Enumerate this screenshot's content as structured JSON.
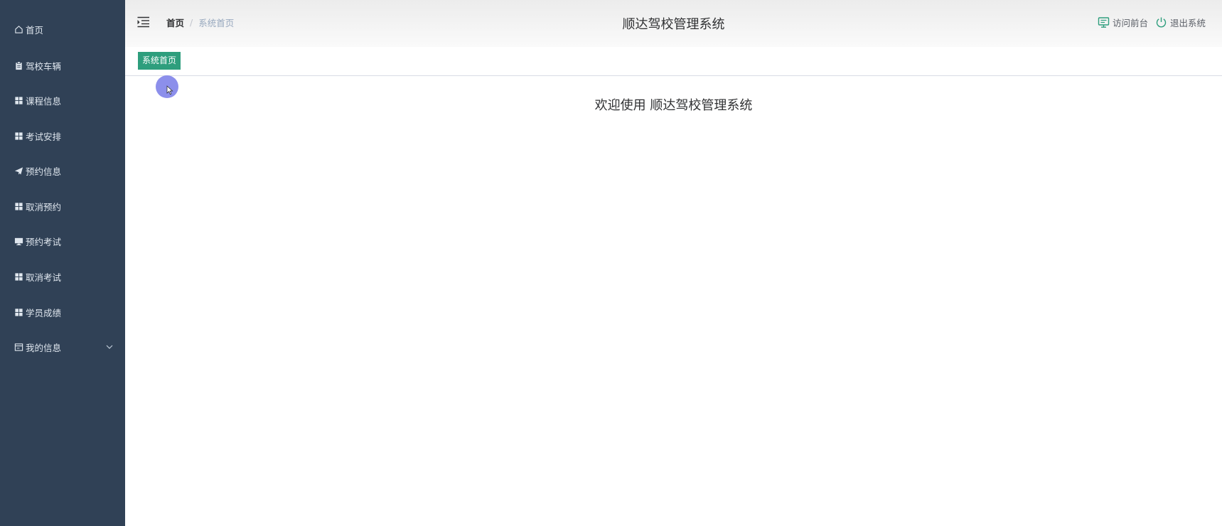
{
  "sidebar": {
    "items": [
      {
        "label": "首页",
        "icon": "home-icon"
      },
      {
        "label": "驾校车辆",
        "icon": "clipboard-icon"
      },
      {
        "label": "课程信息",
        "icon": "grid-icon"
      },
      {
        "label": "考试安排",
        "icon": "grid-icon"
      },
      {
        "label": "预约信息",
        "icon": "send-icon"
      },
      {
        "label": "取消预约",
        "icon": "grid-icon"
      },
      {
        "label": "预约考试",
        "icon": "monitor-icon"
      },
      {
        "label": "取消考试",
        "icon": "grid-icon"
      },
      {
        "label": "学员成绩",
        "icon": "grid-icon"
      },
      {
        "label": "我的信息",
        "icon": "window-icon"
      }
    ]
  },
  "header": {
    "breadcrumb": {
      "home": "首页",
      "separator": "/",
      "current": "系统首页"
    },
    "title": "顺达驾校管理系统",
    "visit_frontend": "访问前台",
    "logout": "退出系统"
  },
  "tags": {
    "active": "系统首页"
  },
  "main": {
    "welcome": "欢迎使用 顺达驾校管理系统"
  },
  "colors": {
    "sidebar_bg": "#304156",
    "accent": "#2e9e7d",
    "header_icon": "#2e9e7d"
  }
}
